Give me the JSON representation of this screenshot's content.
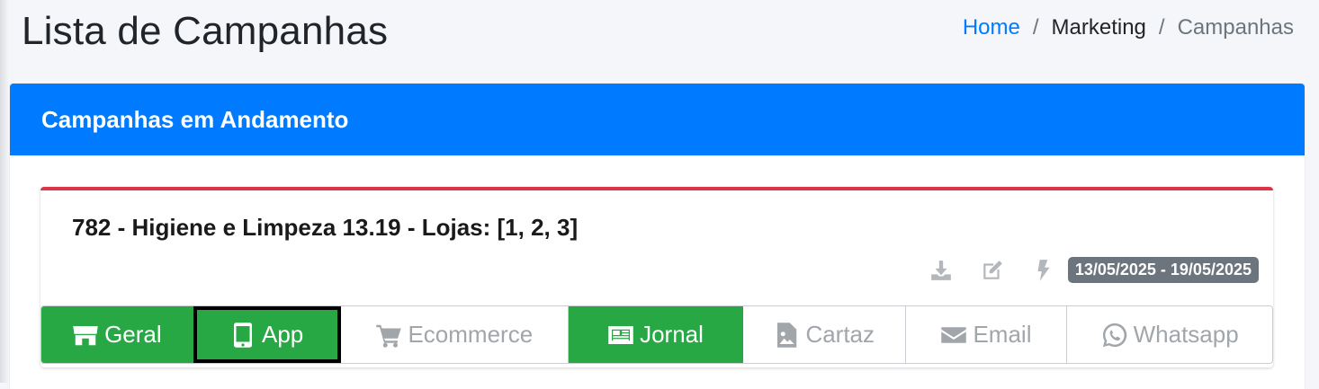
{
  "page": {
    "title": "Lista de Campanhas"
  },
  "breadcrumb": {
    "home": "Home",
    "section": "Marketing",
    "current": "Campanhas",
    "separator": "/"
  },
  "card": {
    "title": "Campanhas em Andamento"
  },
  "campaign": {
    "title": "782 - Higiene e Limpeza 13.19 - Lojas: [1, 2, 3]",
    "date_range": "13/05/2025 - 19/05/2025",
    "actions": [
      {
        "icon": "download-icon"
      },
      {
        "icon": "edit-icon"
      },
      {
        "icon": "bolt-icon"
      }
    ]
  },
  "channels": [
    {
      "label": "Geral",
      "icon": "store-icon",
      "active": true
    },
    {
      "label": "App",
      "icon": "mobile-icon",
      "active": true,
      "selected": true
    },
    {
      "label": "Ecommerce",
      "icon": "cart-icon",
      "active": false
    },
    {
      "label": "Jornal",
      "icon": "newspaper-icon",
      "active": true
    },
    {
      "label": "Cartaz",
      "icon": "file-image-icon",
      "active": false
    },
    {
      "label": "Email",
      "icon": "envelope-icon",
      "active": false
    },
    {
      "label": "Whatsapp",
      "icon": "whatsapp-icon",
      "active": false
    }
  ],
  "colors": {
    "primary": "#007bff",
    "success": "#28a745",
    "danger": "#dc3545",
    "secondary": "#6c757d",
    "muted_icon": "#b3b7bb"
  }
}
